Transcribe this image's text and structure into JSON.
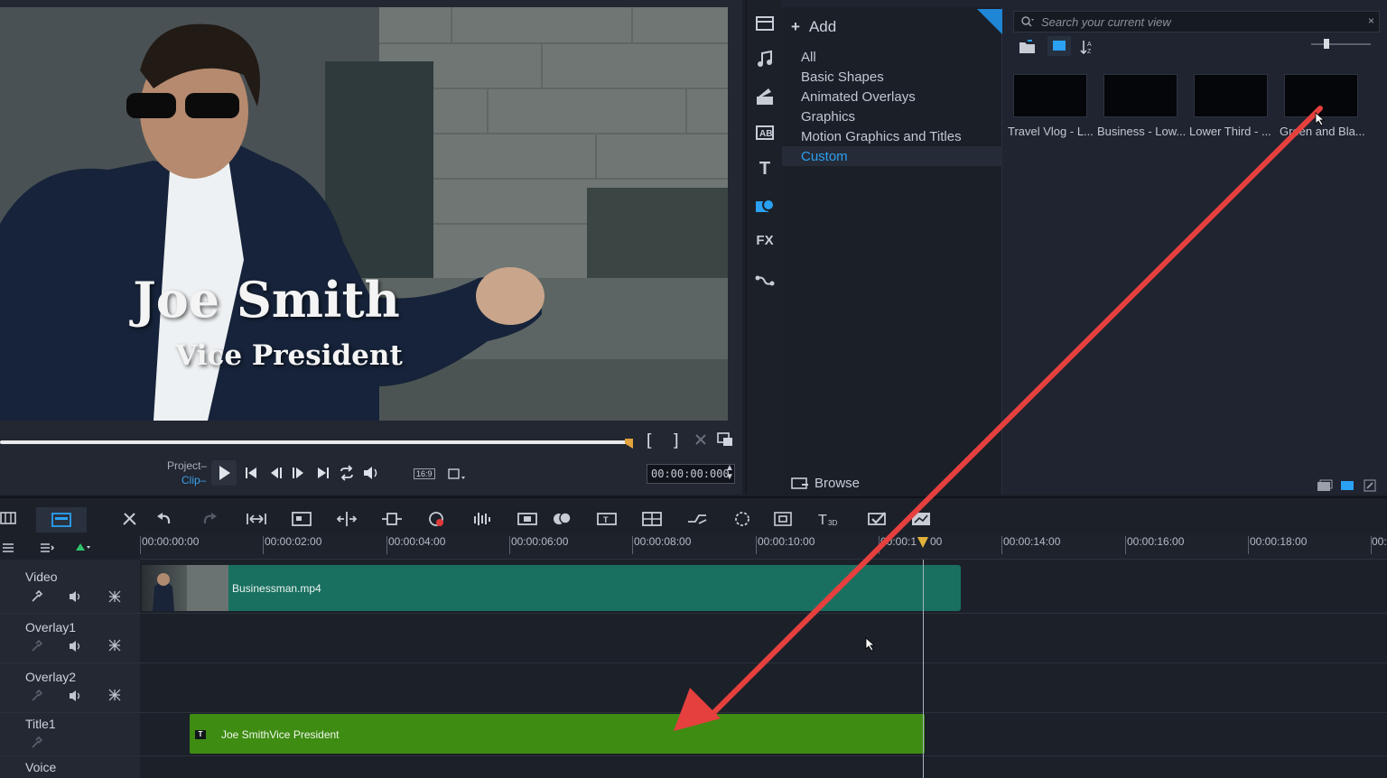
{
  "preview": {
    "title_line1": "Joe Smith",
    "title_line2": "Vice President",
    "mark_in": "[",
    "mark_out": "]",
    "project_label": "Project",
    "clip_label": "Clip",
    "aspect": "16:9",
    "timecode": "00:00:00:000"
  },
  "library": {
    "add_label": "Add",
    "categories": [
      "All",
      "Basic Shapes",
      "Animated Overlays",
      "Graphics",
      "Motion Graphics and Titles",
      "Custom"
    ],
    "selected_category": "Custom",
    "browse_label": "Browse",
    "search_placeholder": "Search your current view",
    "items": [
      "Travel Vlog - L...",
      "Business - Low...",
      "Lower Third - ...",
      "Green and Bla..."
    ]
  },
  "side_icons": [
    "media-icon",
    "audio-icon",
    "instant-project-icon",
    "transition-icon",
    "title-icon",
    "graphics-icon",
    "fx-icon",
    "path-icon"
  ],
  "side_icon_labels": {
    "title": "T",
    "fx": "FX"
  },
  "timeline": {
    "ruler_ticks": [
      "00:00:00:00",
      "00:00:02:00",
      "00:00:04:00",
      "00:00:06:00",
      "00:00:08:00",
      "00:00:10:00",
      "00:00:12:00",
      "00:00:14:00",
      "00:00:16:00",
      "00:00:18:00",
      "00:"
    ],
    "ruler_tick_partial": "00:00:1",
    "ruler_tick_partial_b": "00",
    "tracks": [
      "Video",
      "Overlay1",
      "Overlay2",
      "Title1",
      "Voice"
    ],
    "video_clip": "Businessman.mp4",
    "title_clip": "Joe SmithVice President",
    "title_clip_icon": "T"
  },
  "colors": {
    "accent": "#2d9ff0",
    "video_clip": "#1a7060",
    "title_clip": "#3e8c12",
    "annotation_arrow": "#e5403e"
  }
}
